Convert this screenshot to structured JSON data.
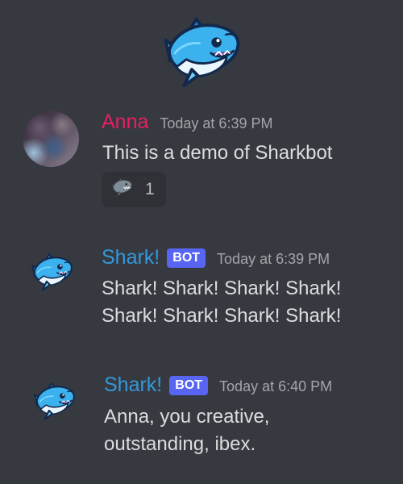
{
  "colors": {
    "background": "#36393f",
    "user_name": "#e91e63",
    "bot_name": "#3498db",
    "bot_tag": "#5865f2",
    "timestamp": "#a3a6aa",
    "text": "#dcddde"
  },
  "header_logo": {
    "icon": "shark-mascot-icon"
  },
  "messages": [
    {
      "author": "Anna",
      "avatar_icon": "user-avatar-photo",
      "timestamp": "Today at 6:39 PM",
      "lines": [
        "This is a demo of Sharkbot"
      ],
      "reaction": {
        "icon": "shark-emoji-icon",
        "count": "1"
      }
    },
    {
      "author": "Shark!",
      "avatar_icon": "shark-mascot-icon",
      "tag": "BOT",
      "timestamp": "Today at 6:39 PM",
      "lines": [
        "Shark! Shark! Shark! Shark!",
        "Shark! Shark! Shark! Shark!"
      ]
    },
    {
      "author": "Shark!",
      "avatar_icon": "shark-mascot-icon",
      "tag": "BOT",
      "timestamp": "Today at 6:40 PM",
      "lines": [
        "Anna, you creative,",
        "outstanding, ibex."
      ]
    }
  ]
}
